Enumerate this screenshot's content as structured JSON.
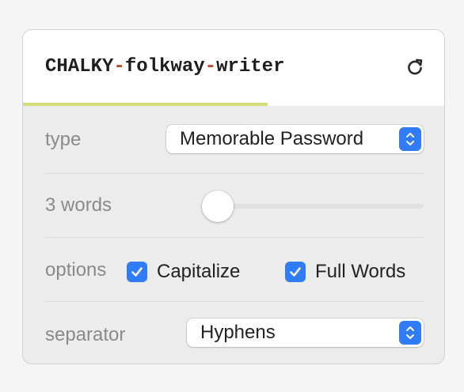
{
  "password": {
    "parts": [
      "CHALKY",
      "-",
      "folkway",
      "-",
      "writer"
    ],
    "strength": 0.58,
    "separator_color": "#b84d2b",
    "strength_color": "#d5dd7a"
  },
  "header": {
    "refresh_icon": "refresh-icon"
  },
  "type_row": {
    "label": "type",
    "selected": "Memorable Password"
  },
  "words_row": {
    "label": "3 words",
    "value": 3,
    "min": 3,
    "max": 15
  },
  "options_row": {
    "label": "options",
    "capitalize": {
      "label": "Capitalize",
      "checked": true
    },
    "full_words": {
      "label": "Full Words",
      "checked": true
    }
  },
  "separator_row": {
    "label": "separator",
    "selected": "Hyphens"
  },
  "colors": {
    "accent": "#2f7cf6",
    "label_gray": "#8a8a8a"
  }
}
